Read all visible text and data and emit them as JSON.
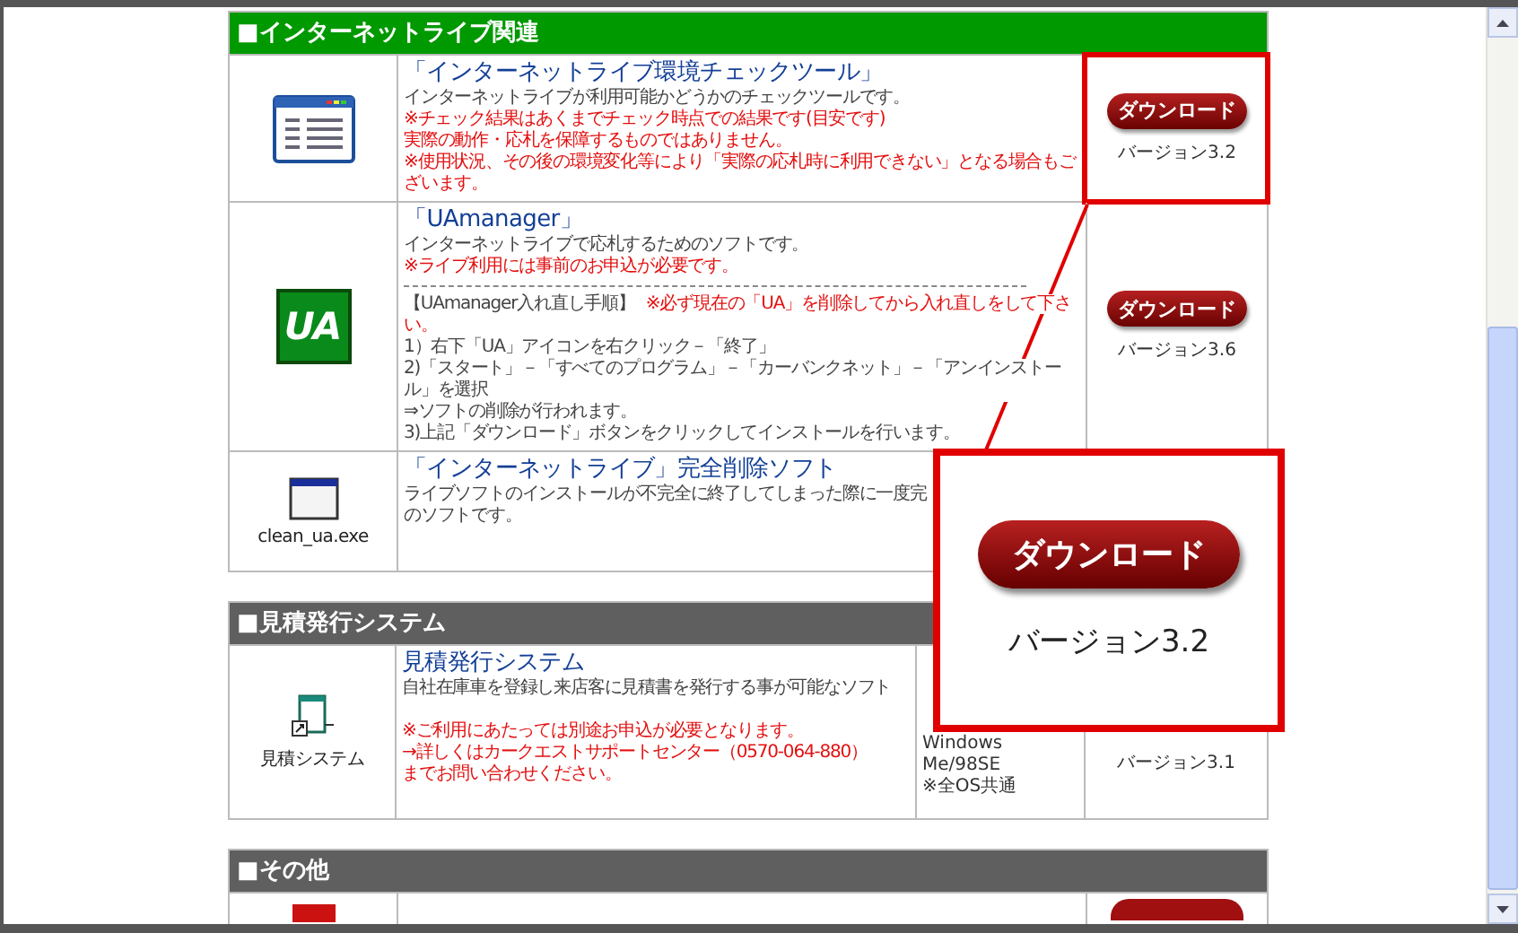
{
  "sections": [
    {
      "title": "■インターネットライブ関連",
      "color": "#009900",
      "items": [
        {
          "icon": {
            "kind": "window-list"
          },
          "title": "「インターネットライブ環境チェックツール」",
          "highlighted": true,
          "download": "ダウンロード",
          "version": "バージョン3.2",
          "lines": [
            {
              "kind": "text",
              "color": "#444444",
              "text": "インターネットライブが利用可能かどうかのチェックツールです。"
            },
            {
              "kind": "text",
              "color": "#e31010",
              "text": "※チェック結果はあくまでチェック時点での結果です(目安です)"
            },
            {
              "kind": "text",
              "color": "#e31010",
              "text": "実際の動作・応札を保障するものではありません。"
            },
            {
              "kind": "text",
              "color": "#e31010",
              "text": "※使用状況、その後の環境変化等により「実際の応札時に利用できない」となる場合もございます。"
            }
          ]
        },
        {
          "icon": {
            "kind": "logo",
            "label": "UA"
          },
          "title": "「UAmanager」",
          "highlighted": false,
          "download": "ダウンロード",
          "version": "バージョン3.6",
          "lines": [
            {
              "kind": "text",
              "color": "#444444",
              "text": "インターネットライブで応札するためのソフトです。"
            },
            {
              "kind": "text",
              "color": "#e31010",
              "text": "※ライブ利用には事前のお申込が必要です。"
            },
            {
              "kind": "divider"
            },
            {
              "kind": "text",
              "color": "#444444",
              "text": "【UAmanager入れ直し手順】",
              "suffix": {
                "color": "#e31010",
                "text": "※必ず現在の「UA」を削除してから入れ直しをして下さい。"
              }
            },
            {
              "kind": "text",
              "color": "#444444",
              "text": "1）右下「UA」アイコンを右クリック－「終了」"
            },
            {
              "kind": "text",
              "color": "#444444",
              "text": "2)「スタート」－「すべてのプログラム」－「カーバンクネット」－「アンインストール」を選択"
            },
            {
              "kind": "text",
              "color": "#444444",
              "text": "⇒ソフトの削除が行われます。"
            },
            {
              "kind": "text",
              "color": "#444444",
              "text": "3)上記「ダウンロード」ボタンをクリックしてインストールを行います。"
            }
          ]
        },
        {
          "icon": {
            "kind": "window",
            "caption": "clean_ua.exe"
          },
          "title": "「インターネットライブ」完全削除ソフト",
          "lines": [
            {
              "kind": "text",
              "color": "#444444",
              "text": "ライブソフトのインストールが不完全に終了してしまった際に一度完"
            },
            {
              "kind": "text",
              "color": "#444444",
              "text": "のソフトです。"
            }
          ]
        }
      ]
    },
    {
      "title": "■見積発行システム",
      "color": "#5f5f5f",
      "items": [
        {
          "icon": {
            "kind": "document",
            "caption": "見積システム"
          },
          "title": "見積発行システム",
          "highlighted": false,
          "version": "バージョン3.1",
          "os": [
            "Windows",
            "Me/98SE",
            "※全OS共通"
          ],
          "lines": [
            {
              "kind": "text",
              "color": "#444444",
              "text": "自社在庫車を登録し来店客に見積書を発行する事が可能なソフト"
            },
            {
              "kind": "blank"
            },
            {
              "kind": "text",
              "color": "#e31010",
              "text": "※ご利用にあたっては別途お申込が必要となります。"
            },
            {
              "kind": "text",
              "color": "#e31010",
              "text": "→詳しくはカークエストサポートセンター（0570-064-880）"
            },
            {
              "kind": "text",
              "color": "#e31010",
              "text": "までお問い合わせください。"
            }
          ]
        }
      ]
    },
    {
      "title": "■その他",
      "color": "#5f5f5f",
      "items": [
        {
          "icon": {
            "kind": "red-square"
          },
          "highlighted": false,
          "button_stub": true
        }
      ]
    }
  ],
  "callout": {
    "button": "ダウンロード",
    "version": "バージョン3.2"
  }
}
